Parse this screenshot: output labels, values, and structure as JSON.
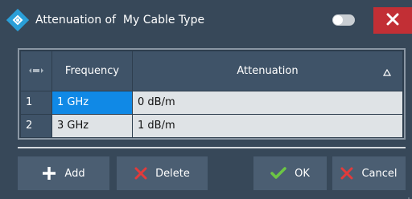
{
  "window": {
    "title_prefix": "Attenuation of",
    "title_name": "My Cable Type"
  },
  "table": {
    "columns": [
      "Frequency",
      "Attenuation"
    ],
    "rows": [
      {
        "num": "1",
        "frequency": "1 GHz",
        "attenuation": "0 dB/m"
      },
      {
        "num": "2",
        "frequency": "3 GHz",
        "attenuation": "1 dB/m"
      }
    ]
  },
  "buttons": {
    "add": "Add",
    "delete": "Delete",
    "ok": "OK",
    "cancel": "Cancel"
  },
  "icons": {
    "app": "rohde-schwarz-diamond-icon",
    "close": "close-icon",
    "sort": "sort-ascending-icon"
  },
  "colors": {
    "titlebar": "#374859",
    "close": "#c22f35",
    "selection": "#1089e6",
    "header": "#3f5368",
    "cell": "#dfe3e6",
    "ok_check": "#6cc644",
    "delete_x": "#e23b3b"
  }
}
